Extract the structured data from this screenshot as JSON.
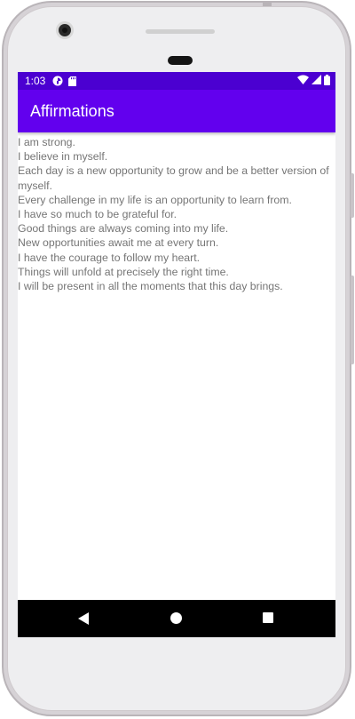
{
  "status_bar": {
    "time": "1:03",
    "icons": [
      "data-saver-icon",
      "sd-card-icon",
      "wifi-icon",
      "cell-signal-icon",
      "battery-icon"
    ],
    "background": "#4b00d1"
  },
  "app_bar": {
    "title": "Affirmations",
    "background": "#6200ee"
  },
  "affirmations": [
    "I am strong.",
    "I believe in myself.",
    "Each day is a new opportunity to grow and be a better version of myself.",
    "Every challenge in my life is an opportunity to learn from.",
    "I have so much to be grateful for.",
    "Good things are always coming into my life.",
    "New opportunities await me at every turn.",
    "I have the courage to follow my heart.",
    "Things will unfold at precisely the right time.",
    "I will be present in all the moments that this day brings."
  ],
  "nav_bar": {
    "buttons": [
      "back-icon",
      "home-icon",
      "recents-icon"
    ]
  }
}
